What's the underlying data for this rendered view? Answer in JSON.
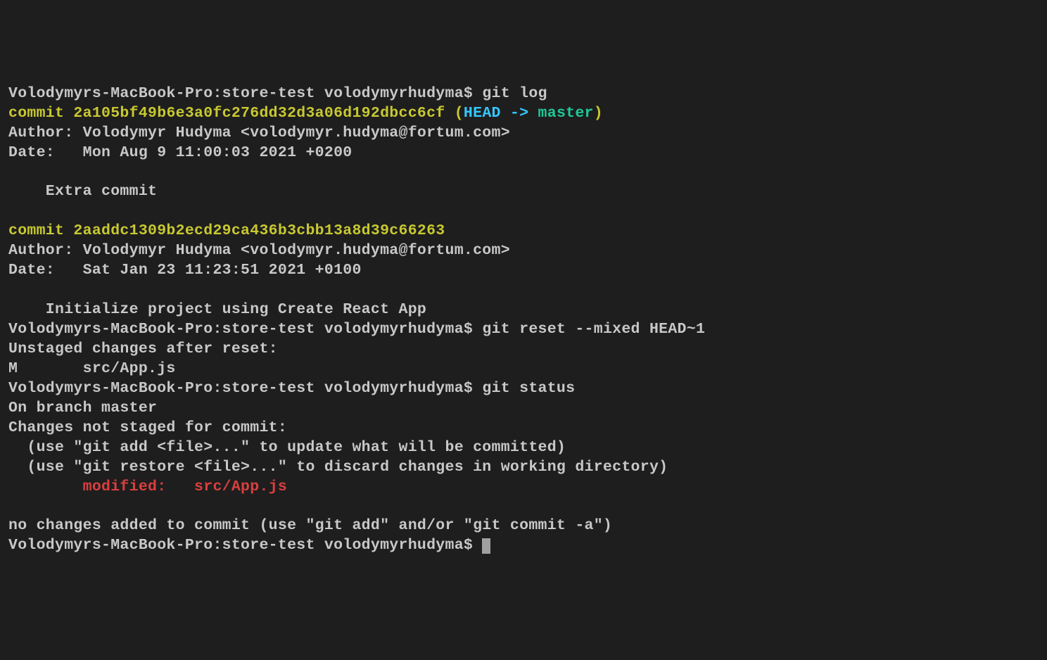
{
  "prompt": "Volodymyrs-MacBook-Pro:store-test volodymyrhudyma$ ",
  "cmd_log": "git log",
  "commit1": {
    "label": "commit ",
    "hash": "2a105bf49b6e3a0fc276dd32d3a06d192dbcc6cf",
    "paren_open": " (",
    "head": "HEAD -> ",
    "branch": "master",
    "paren_close": ")",
    "author": "Author: Volodymyr Hudyma <volodymyr.hudyma@fortum.com>",
    "date": "Date:   Mon Aug 9 11:00:03 2021 +0200",
    "message": "    Extra commit"
  },
  "commit2": {
    "line": "commit 2aaddc1309b2ecd29ca436b3cbb13a8d39c66263",
    "author": "Author: Volodymyr Hudyma <volodymyr.hudyma@fortum.com>",
    "date": "Date:   Sat Jan 23 11:23:51 2021 +0100",
    "message": "    Initialize project using Create React App"
  },
  "cmd_reset": "git reset --mixed HEAD~1",
  "reset_output1": "Unstaged changes after reset:",
  "reset_output2": "M       src/App.js",
  "cmd_status": "git status",
  "status": {
    "branch": "On branch master",
    "not_staged": "Changes not staged for commit:",
    "hint1": "  (use \"git add <file>...\" to update what will be committed)",
    "hint2": "  (use \"git restore <file>...\" to discard changes in working directory)",
    "modified": "        modified:   src/App.js",
    "no_changes": "no changes added to commit (use \"git add\" and/or \"git commit -a\")"
  }
}
